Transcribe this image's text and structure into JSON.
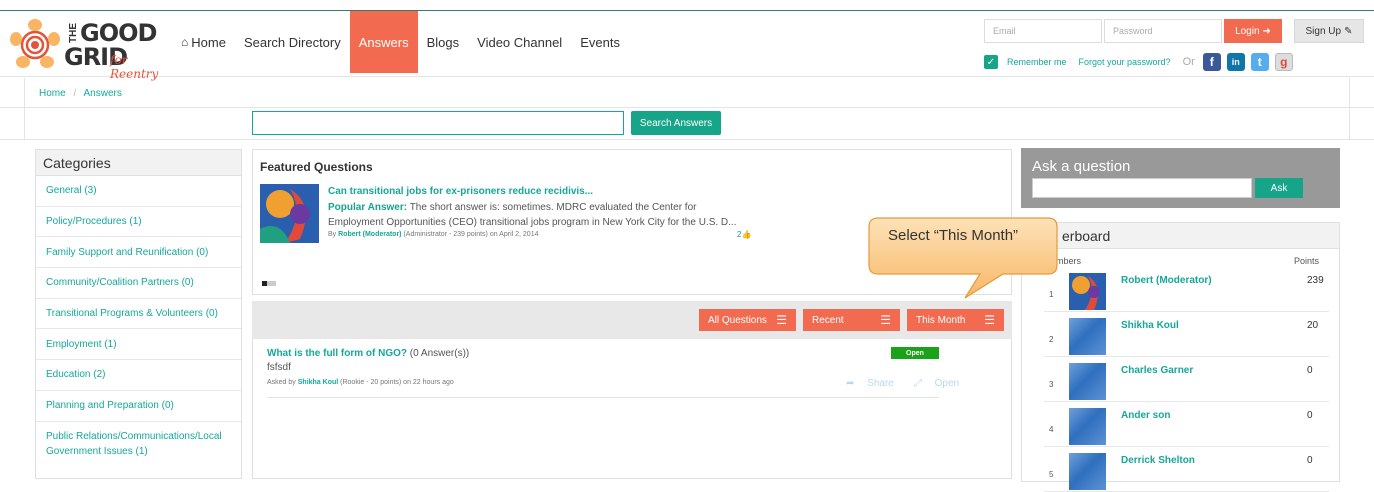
{
  "header": {
    "logo": {
      "the": "THE",
      "good": "GOOD",
      "grid": "GRID",
      "tagline": "for Reentry"
    },
    "nav": [
      {
        "label": "Home",
        "active": false,
        "icon": "home-icon"
      },
      {
        "label": "Search Directory",
        "active": false
      },
      {
        "label": "Answers",
        "active": true
      },
      {
        "label": "Blogs",
        "active": false
      },
      {
        "label": "Video Channel",
        "active": false
      },
      {
        "label": "Events",
        "active": false
      }
    ],
    "login": {
      "email_placeholder": "Email",
      "password_placeholder": "Password",
      "login_label": "Login",
      "signup_label": "Sign Up",
      "remember_label": "Remember me",
      "forgot_label": "Forgot your password?",
      "or_label": "Or",
      "social": [
        "facebook-icon",
        "linkedin-icon",
        "twitter-icon",
        "google-icon"
      ]
    }
  },
  "breadcrumb": {
    "home": "Home",
    "separator": "/",
    "current": "Answers"
  },
  "search": {
    "button_label": "Search Answers",
    "value": ""
  },
  "categories": {
    "title": "Categories",
    "items": [
      "General (3)",
      "Policy/Procedures (1)",
      "Family Support and Reunification (0)",
      "Community/Coalition Partners (0)",
      "Transitional Programs & Volunteers (0)",
      "Employment (1)",
      "Education (2)",
      "Planning and Preparation (0)",
      "Public Relations/Communications/Local Government Issues (1)"
    ]
  },
  "featured": {
    "title": "Featured Questions",
    "question": "Can transitional jobs for ex-prisoners reduce recidivis...",
    "popular_label": "Popular Answer:",
    "answer": "The short answer is: sometimes. MDRC evaluated the Center for Employment Opportunities (CEO) transitional jobs program in New York City for the U.S. D...",
    "by": "By",
    "author": "Robert (Moderator)",
    "author_meta": "(Administrator - 239 points)  on April 2, 2014",
    "likes": "2"
  },
  "filters": {
    "all_questions": "All Questions",
    "recent": "Recent",
    "this_month": "This Month"
  },
  "question": {
    "title": "What is the full form of NGO?",
    "count": "(0 Answer(s))",
    "body": "fsfsdf",
    "asked_by": "Asked by",
    "author": "Shikha Koul",
    "author_meta": "(Rookie - 20 points)  on 22 hours ago",
    "status": "Open",
    "share_label": "Share",
    "open_label": "Open"
  },
  "ask": {
    "title": "Ask a question",
    "button_label": "Ask"
  },
  "leaderboard": {
    "title": "erboard",
    "members_label": "mbers",
    "points_label": "Points",
    "rows": [
      {
        "rank": "1",
        "name": "Robert (Moderator)",
        "points": "239"
      },
      {
        "rank": "2",
        "name": "Shikha Koul",
        "points": "20"
      },
      {
        "rank": "3",
        "name": "Charles Garner",
        "points": "0"
      },
      {
        "rank": "4",
        "name": "Ander son",
        "points": "0"
      },
      {
        "rank": "5",
        "name": "Derrick Shelton",
        "points": "0"
      }
    ]
  },
  "callout": {
    "text": "Select “This Month”"
  },
  "colors": {
    "accent": "#f26a4f",
    "teal": "#17a58a",
    "link": "#15a89a",
    "callout": "#f9c27c"
  }
}
